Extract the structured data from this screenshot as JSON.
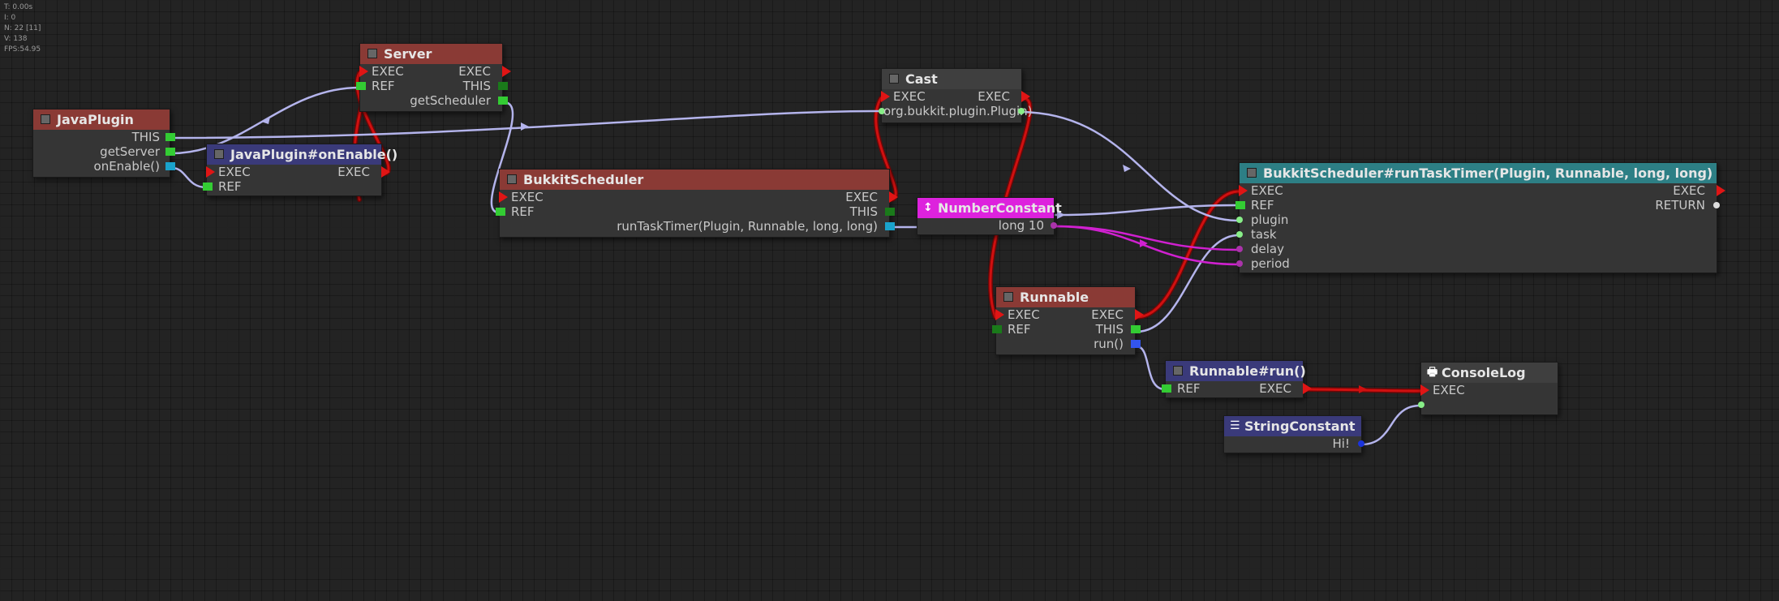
{
  "stats": [
    "T: 0.00s",
    "I: 0",
    "N: 22 [11]",
    "V: 138",
    "FPS:54.95"
  ],
  "colors": {
    "exec": "#e01515",
    "ref": "#33cc33",
    "obj": "#1a7a1a",
    "method": "#1aa3cc",
    "runnable": "#3355ee",
    "wire": "#b0b0e8",
    "exec_wire": "#c01010",
    "num_wire": "#d020d0"
  },
  "nodes": {
    "javaplugin": {
      "title": "JavaPlugin",
      "outputs": [
        "THIS",
        "getServer",
        "onEnable()"
      ]
    },
    "onenable": {
      "title": "JavaPlugin#onEnable()",
      "inputs": [
        "EXEC",
        "REF"
      ],
      "outputs": [
        "EXEC"
      ]
    },
    "server": {
      "title": "Server",
      "inputs": [
        "EXEC",
        "REF"
      ],
      "outputs": [
        "EXEC",
        "THIS",
        "getScheduler"
      ]
    },
    "bukkitscheduler": {
      "title": "BukkitScheduler",
      "inputs": [
        "EXEC",
        "REF"
      ],
      "outputs": [
        "EXEC",
        "THIS",
        "runTaskTimer(Plugin, Runnable, long, long)"
      ]
    },
    "cast": {
      "title": "Cast",
      "inputs": [
        "EXEC",
        "org.bukkit.plugin.Plugin)"
      ],
      "outputs": [
        "EXEC"
      ]
    },
    "numberconstant": {
      "title": "NumberConstant",
      "icon": "↕",
      "outputs": [
        "long 10"
      ]
    },
    "runtasktimer": {
      "title": "BukkitScheduler#runTaskTimer(Plugin, Runnable, long, long)",
      "inputs": [
        "EXEC",
        "REF",
        "plugin",
        "task",
        "delay",
        "period"
      ],
      "outputs": [
        "EXEC",
        "RETURN"
      ]
    },
    "runnable": {
      "title": "Runnable",
      "inputs": [
        "EXEC",
        "REF"
      ],
      "outputs": [
        "EXEC",
        "THIS",
        "run()"
      ]
    },
    "runnablerun": {
      "title": "Runnable#run()",
      "inputs": [
        "REF"
      ],
      "outputs": [
        "EXEC"
      ]
    },
    "consolelog": {
      "title": "ConsoleLog",
      "icon": "🖶",
      "inputs": [
        "EXEC"
      ]
    },
    "stringconstant": {
      "title": "StringConstant",
      "icon": "☰",
      "outputs": [
        "Hi!"
      ]
    }
  }
}
